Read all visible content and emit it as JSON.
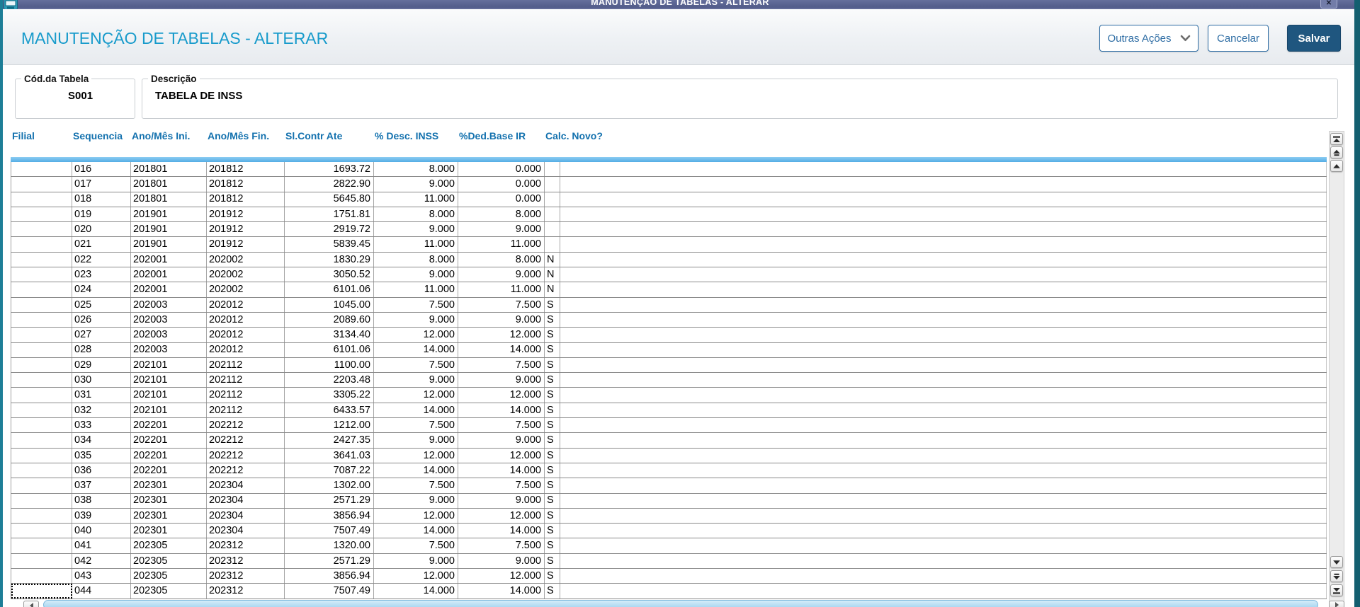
{
  "window": {
    "titlebar_title": "MANUTENÇÃO DE TABELAS - ALTERAR",
    "close_glyph": "✕"
  },
  "header": {
    "title": "MANUTENÇÃO DE TABELAS - ALTERAR",
    "buttons": {
      "other_actions": "Outras Ações",
      "cancel": "Cancelar",
      "save": "Salvar"
    }
  },
  "form": {
    "code": {
      "label": "Cód.da Tabela",
      "value": "S001"
    },
    "description": {
      "label": "Descrição",
      "value": "TABELA DE INSS"
    }
  },
  "grid": {
    "columns": [
      {
        "label": "Filial",
        "align": "left"
      },
      {
        "label": "Sequencia",
        "align": "left"
      },
      {
        "label": "Ano/Mês Ini.",
        "align": "left"
      },
      {
        "label": "Ano/Mês Fin.",
        "align": "left"
      },
      {
        "label": "Sl.Contr Ate",
        "align": "right"
      },
      {
        "label": "% Desc. INSS",
        "align": "right"
      },
      {
        "label": "%Ded.Base IR",
        "align": "right"
      },
      {
        "label": "Calc. Novo?",
        "align": "left"
      }
    ],
    "rows": [
      [
        "",
        "016",
        "201801",
        "201812",
        "1693.72",
        "8.000",
        "0.000",
        ""
      ],
      [
        "",
        "017",
        "201801",
        "201812",
        "2822.90",
        "9.000",
        "0.000",
        ""
      ],
      [
        "",
        "018",
        "201801",
        "201812",
        "5645.80",
        "11.000",
        "0.000",
        ""
      ],
      [
        "",
        "019",
        "201901",
        "201912",
        "1751.81",
        "8.000",
        "8.000",
        ""
      ],
      [
        "",
        "020",
        "201901",
        "201912",
        "2919.72",
        "9.000",
        "9.000",
        ""
      ],
      [
        "",
        "021",
        "201901",
        "201912",
        "5839.45",
        "11.000",
        "11.000",
        ""
      ],
      [
        "",
        "022",
        "202001",
        "202002",
        "1830.29",
        "8.000",
        "8.000",
        "N"
      ],
      [
        "",
        "023",
        "202001",
        "202002",
        "3050.52",
        "9.000",
        "9.000",
        "N"
      ],
      [
        "",
        "024",
        "202001",
        "202002",
        "6101.06",
        "11.000",
        "11.000",
        "N"
      ],
      [
        "",
        "025",
        "202003",
        "202012",
        "1045.00",
        "7.500",
        "7.500",
        "S"
      ],
      [
        "",
        "026",
        "202003",
        "202012",
        "2089.60",
        "9.000",
        "9.000",
        "S"
      ],
      [
        "",
        "027",
        "202003",
        "202012",
        "3134.40",
        "12.000",
        "12.000",
        "S"
      ],
      [
        "",
        "028",
        "202003",
        "202012",
        "6101.06",
        "14.000",
        "14.000",
        "S"
      ],
      [
        "",
        "029",
        "202101",
        "202112",
        "1100.00",
        "7.500",
        "7.500",
        "S"
      ],
      [
        "",
        "030",
        "202101",
        "202112",
        "2203.48",
        "9.000",
        "9.000",
        "S"
      ],
      [
        "",
        "031",
        "202101",
        "202112",
        "3305.22",
        "12.000",
        "12.000",
        "S"
      ],
      [
        "",
        "032",
        "202101",
        "202112",
        "6433.57",
        "14.000",
        "14.000",
        "S"
      ],
      [
        "",
        "033",
        "202201",
        "202212",
        "1212.00",
        "7.500",
        "7.500",
        "S"
      ],
      [
        "",
        "034",
        "202201",
        "202212",
        "2427.35",
        "9.000",
        "9.000",
        "S"
      ],
      [
        "",
        "035",
        "202201",
        "202212",
        "3641.03",
        "12.000",
        "12.000",
        "S"
      ],
      [
        "",
        "036",
        "202201",
        "202212",
        "7087.22",
        "14.000",
        "14.000",
        "S"
      ],
      [
        "",
        "037",
        "202301",
        "202304",
        "1302.00",
        "7.500",
        "7.500",
        "S"
      ],
      [
        "",
        "038",
        "202301",
        "202304",
        "2571.29",
        "9.000",
        "9.000",
        "S"
      ],
      [
        "",
        "039",
        "202301",
        "202304",
        "3856.94",
        "12.000",
        "12.000",
        "S"
      ],
      [
        "",
        "040",
        "202301",
        "202304",
        "7507.49",
        "14.000",
        "14.000",
        "S"
      ],
      [
        "",
        "041",
        "202305",
        "202312",
        "1320.00",
        "7.500",
        "7.500",
        "S"
      ],
      [
        "",
        "042",
        "202305",
        "202312",
        "2571.29",
        "9.000",
        "9.000",
        "S"
      ],
      [
        "",
        "043",
        "202305",
        "202312",
        "3856.94",
        "12.000",
        "12.000",
        "S"
      ],
      [
        "",
        "044",
        "202305",
        "202312",
        "7507.49",
        "14.000",
        "14.000",
        "S"
      ]
    ],
    "focused_cell": {
      "row": 28,
      "col": 0
    }
  },
  "colors": {
    "accent_teal": "#189bcb",
    "button_blue": "#2e6da4",
    "save_button_bg": "#1f567f",
    "selection_blue": "#54ade5",
    "titlebar_blue": "#525c8a",
    "window_border_teal": "#1d7e97",
    "grid_header_text": "#1371ae"
  }
}
